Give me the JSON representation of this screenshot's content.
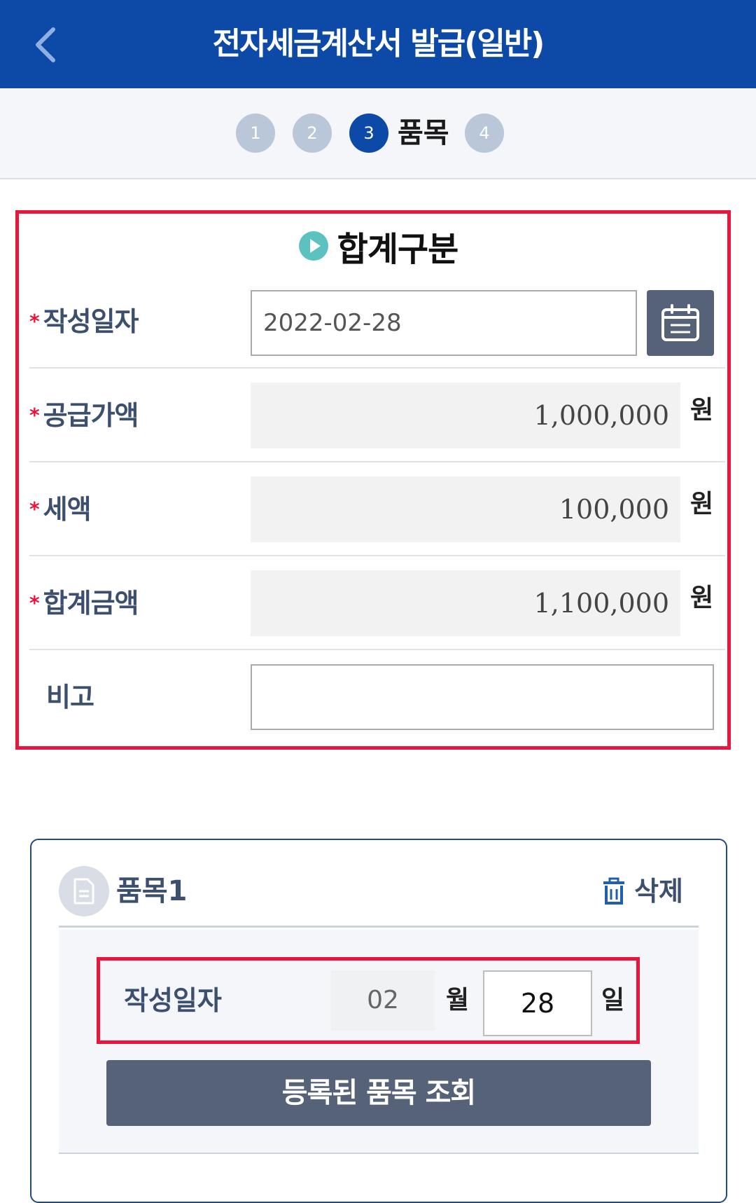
{
  "header": {
    "title": "전자세금계산서 발급(일반)"
  },
  "stepper": {
    "steps": [
      {
        "number": "1"
      },
      {
        "number": "2"
      },
      {
        "number": "3",
        "label": "품목"
      },
      {
        "number": "4"
      }
    ]
  },
  "summary": {
    "title": "합계구분",
    "required_mark": "*",
    "write_date": {
      "label": "작성일자",
      "value": "2022-02-28"
    },
    "supply_amount": {
      "label": "공급가액",
      "value": "1,000,000",
      "unit": "원"
    },
    "tax_amount": {
      "label": "세액",
      "value": "100,000",
      "unit": "원"
    },
    "total_amount": {
      "label": "합계금액",
      "value": "1,100,000",
      "unit": "원"
    },
    "memo": {
      "label": "비고",
      "value": ""
    }
  },
  "item": {
    "title": "품목1",
    "delete_label": "삭제",
    "date_label": "작성일자",
    "month_value": "02",
    "month_unit": "월",
    "day_value": "28",
    "day_unit": "일",
    "lookup_button": "등록된 품목 조회"
  },
  "colors": {
    "header_bg": "#0d4aa7",
    "highlight_border": "#e8163d",
    "button_bg": "#566278",
    "label_text": "#3d4f6e"
  }
}
